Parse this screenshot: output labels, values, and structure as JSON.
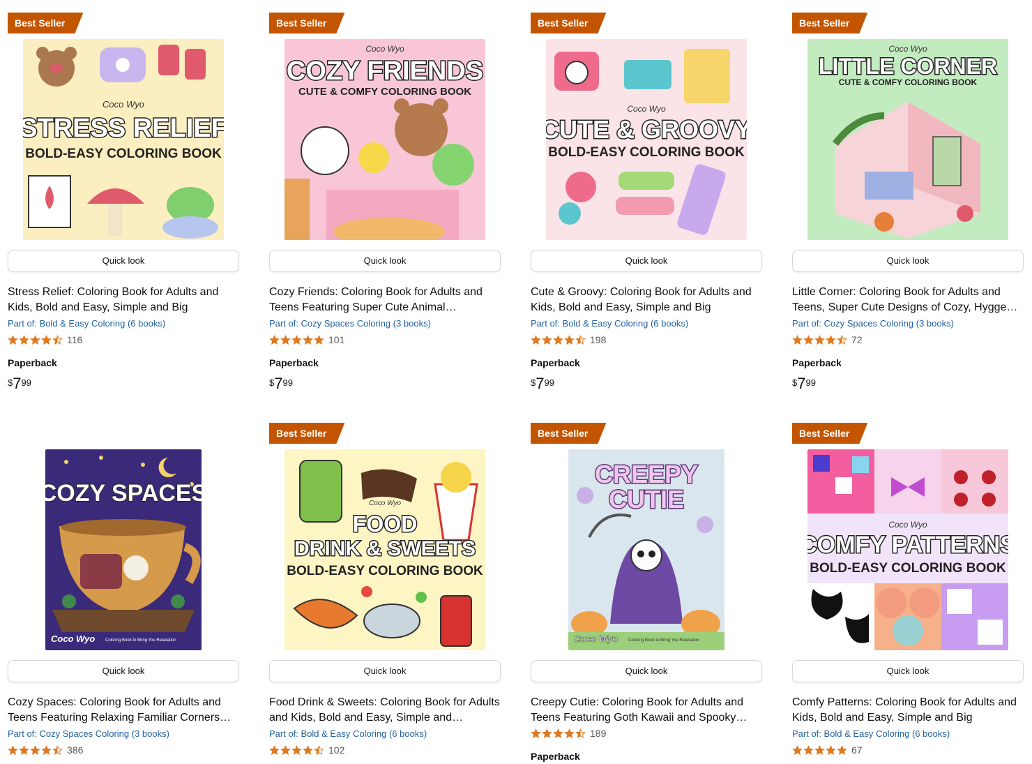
{
  "products": [
    {
      "badge": "Best Seller",
      "quick_look": "Quick look",
      "title": "Stress Relief: Coloring Book for Adults and Kids, Bold and Easy, Simple and Big Designs…",
      "series": "Part of: Bold & Easy Coloring (6 books)",
      "rating": 4.5,
      "review_count": "116",
      "format": "Paperback",
      "price": {
        "currency": "$",
        "whole": "7",
        "fraction": "99"
      },
      "cover": {
        "line1": "STRESS RELIEF",
        "line2": "BOLD-EASY COLORING BOOK",
        "brand": "Coco Wyo",
        "bg": "#fbeec0",
        "accent": "#e05a6b"
      }
    },
    {
      "badge": "Best Seller",
      "quick_look": "Quick look",
      "title": "Cozy Friends: Coloring Book for Adults and Teens Featuring Super Cute Animal…",
      "series": "Part of: Cozy Spaces Coloring (3 books)",
      "rating": 5,
      "review_count": "101",
      "format": "Paperback",
      "price": {
        "currency": "$",
        "whole": "7",
        "fraction": "99"
      },
      "cover": {
        "line1": "COZY FRIENDS",
        "line2": "CUTE & COMFY COLORING BOOK",
        "brand": "Coco Wyo",
        "bg": "#f8c6d6",
        "accent": "#8a5a3a"
      }
    },
    {
      "badge": "Best Seller",
      "quick_look": "Quick look",
      "title": "Cute & Groovy: Coloring Book for Adults and Kids, Bold and Easy, Simple and Big Designs…",
      "series": "Part of: Bold & Easy Coloring (6 books)",
      "rating": 4.5,
      "review_count": "198",
      "format": "Paperback",
      "price": {
        "currency": "$",
        "whole": "7",
        "fraction": "99"
      },
      "cover": {
        "line1": "CUTE & GROOVY",
        "line2": "BOLD-EASY COLORING BOOK",
        "brand": "Coco Wyo",
        "bg": "#fbe4e8",
        "accent": "#3db6c2"
      }
    },
    {
      "badge": "Best Seller",
      "quick_look": "Quick look",
      "title": "Little Corner: Coloring Book for Adults and Teens, Super Cute Designs of Cozy, Hygge…",
      "series": "Part of: Cozy Spaces Coloring (3 books)",
      "rating": 4.5,
      "review_count": "72",
      "format": "Paperback",
      "price": {
        "currency": "$",
        "whole": "7",
        "fraction": "99"
      },
      "cover": {
        "line1": "LITTLE CORNER",
        "line2": "CUTE & COMFY COLORING BOOK",
        "brand": "Coco Wyo",
        "bg": "#c3ebc0",
        "accent": "#4c8a3c"
      }
    },
    {
      "badge": "",
      "quick_look": "Quick look",
      "title": "Cozy Spaces: Coloring Book for Adults and Teens Featuring Relaxing Familiar Corners…",
      "series": "Part of: Cozy Spaces Coloring (3 books)",
      "rating": 4.5,
      "review_count": "386",
      "format": "",
      "price": null,
      "cover": {
        "line1": "COZY SPACES",
        "line2": "",
        "brand": "Coco Wyo",
        "tag": "Coloring Book to Bring You Relaxation",
        "bg": "#3b2a7a",
        "accent": "#f1d36a"
      }
    },
    {
      "badge": "Best Seller",
      "quick_look": "Quick look",
      "title": "Food Drink & Sweets: Coloring Book for Adults and Kids, Bold and Easy, Simple and…",
      "series": "Part of: Bold & Easy Coloring (6 books)",
      "rating": 4.5,
      "review_count": "102",
      "format": "",
      "price": null,
      "cover": {
        "line1": "FOOD",
        "line2": "DRINK & SWEETS",
        "line3": "BOLD-EASY COLORING BOOK",
        "brand": "Coco Wyo",
        "bg": "#fdf5c4",
        "accent": "#d8332f"
      }
    },
    {
      "badge": "Best Seller",
      "quick_look": "Quick look",
      "title": "Creepy Cutie: Coloring Book for Adults and Teens Featuring Goth Kawaii and Spooky…",
      "series": "",
      "rating": 4.5,
      "review_count": "189",
      "format": "Paperback",
      "price": null,
      "cover": {
        "line1": "CREEPY",
        "line2": "CUTIE",
        "brand": "Coco Wyo",
        "tag": "Coloring Book to Bring You Relaxation",
        "bg": "#d9e6ee",
        "accent": "#9a6fc4"
      }
    },
    {
      "badge": "Best Seller",
      "quick_look": "Quick look",
      "title": "Comfy Patterns: Coloring Book for Adults and Kids, Bold and Easy, Simple and Big Designs…",
      "series": "Part of: Bold & Easy Coloring (6 books)",
      "rating": 5,
      "review_count": "67",
      "format": "",
      "price": null,
      "cover": {
        "line1": "COMFY PATTERNS",
        "line2": "BOLD-EASY COLORING BOOK",
        "brand": "Coco Wyo",
        "bg": "#e8d4f4",
        "accent": "#e34f8a"
      }
    }
  ],
  "colors": {
    "badge": "#c45500",
    "star": "#de7921",
    "link": "#2162a1"
  }
}
